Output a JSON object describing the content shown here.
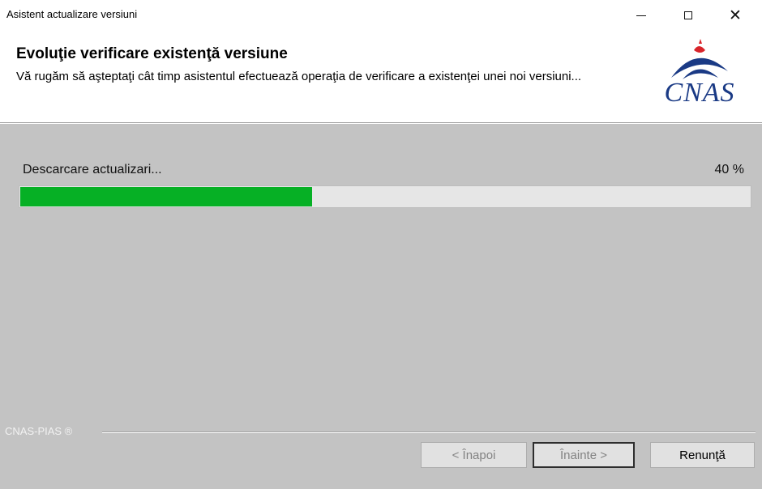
{
  "window": {
    "title": "Asistent actualizare versiuni",
    "minimize_icon": "minimize-icon",
    "maximize_icon": "maximize-icon",
    "close_icon": "close-icon",
    "close_glyph": "✕"
  },
  "header": {
    "title": "Evoluţie verificare existenţă versiune",
    "description": "Vă rugăm să aşteptaţi cât timp asistentul efectuează operaţia de verificare a existenţei unei noi versiuni...",
    "logo": {
      "text": "CNAS",
      "icon": "cnas-logo-icon",
      "colors": {
        "blue": "#1a3a85",
        "red": "#d8242a"
      }
    }
  },
  "progress": {
    "status": "Descarcare actualizari...",
    "percent_label": "40 %",
    "value": 0.4,
    "fill_color": "#06b025"
  },
  "footer": {
    "brand": "CNAS-PIAS ®",
    "buttons": {
      "back": "< Înapoi",
      "next": "Înainte >",
      "cancel": "Renunţă"
    }
  },
  "colors": {
    "content_background": "#c3c3c3",
    "header_background": "#ffffff"
  }
}
